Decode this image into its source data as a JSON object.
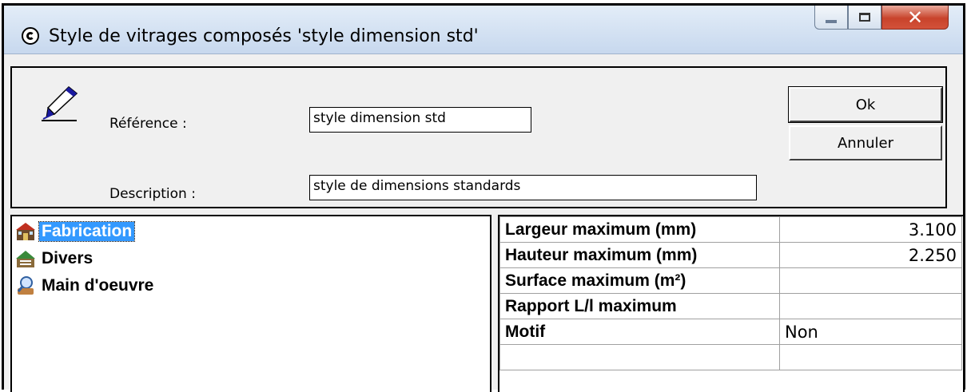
{
  "window": {
    "title": "Style de vitrages composés 'style dimension std'"
  },
  "form": {
    "reference_label": "Référence :",
    "reference_value": "style dimension std",
    "description_label": "Description :",
    "description_value": "style de dimensions standards"
  },
  "buttons": {
    "ok": "Ok",
    "cancel": "Annuler"
  },
  "tree": {
    "items": [
      {
        "label": "Fabrication",
        "icon": "fabrication-icon",
        "selected": true
      },
      {
        "label": "Divers",
        "icon": "divers-icon",
        "selected": false
      },
      {
        "label": "Main d'oeuvre",
        "icon": "main-doeuvre-icon",
        "selected": false
      }
    ]
  },
  "properties": {
    "rows": [
      {
        "name": "Largeur maximum (mm)",
        "value": "3.100"
      },
      {
        "name": "Hauteur maximum (mm)",
        "value": "2.250"
      },
      {
        "name": "Surface maximum (m²)",
        "value": ""
      },
      {
        "name": "Rapport L/l maximum",
        "value": ""
      },
      {
        "name": "Motif",
        "value": "Non"
      }
    ]
  },
  "colors": {
    "selection": "#3399ff",
    "close_button": "#c8432b"
  }
}
